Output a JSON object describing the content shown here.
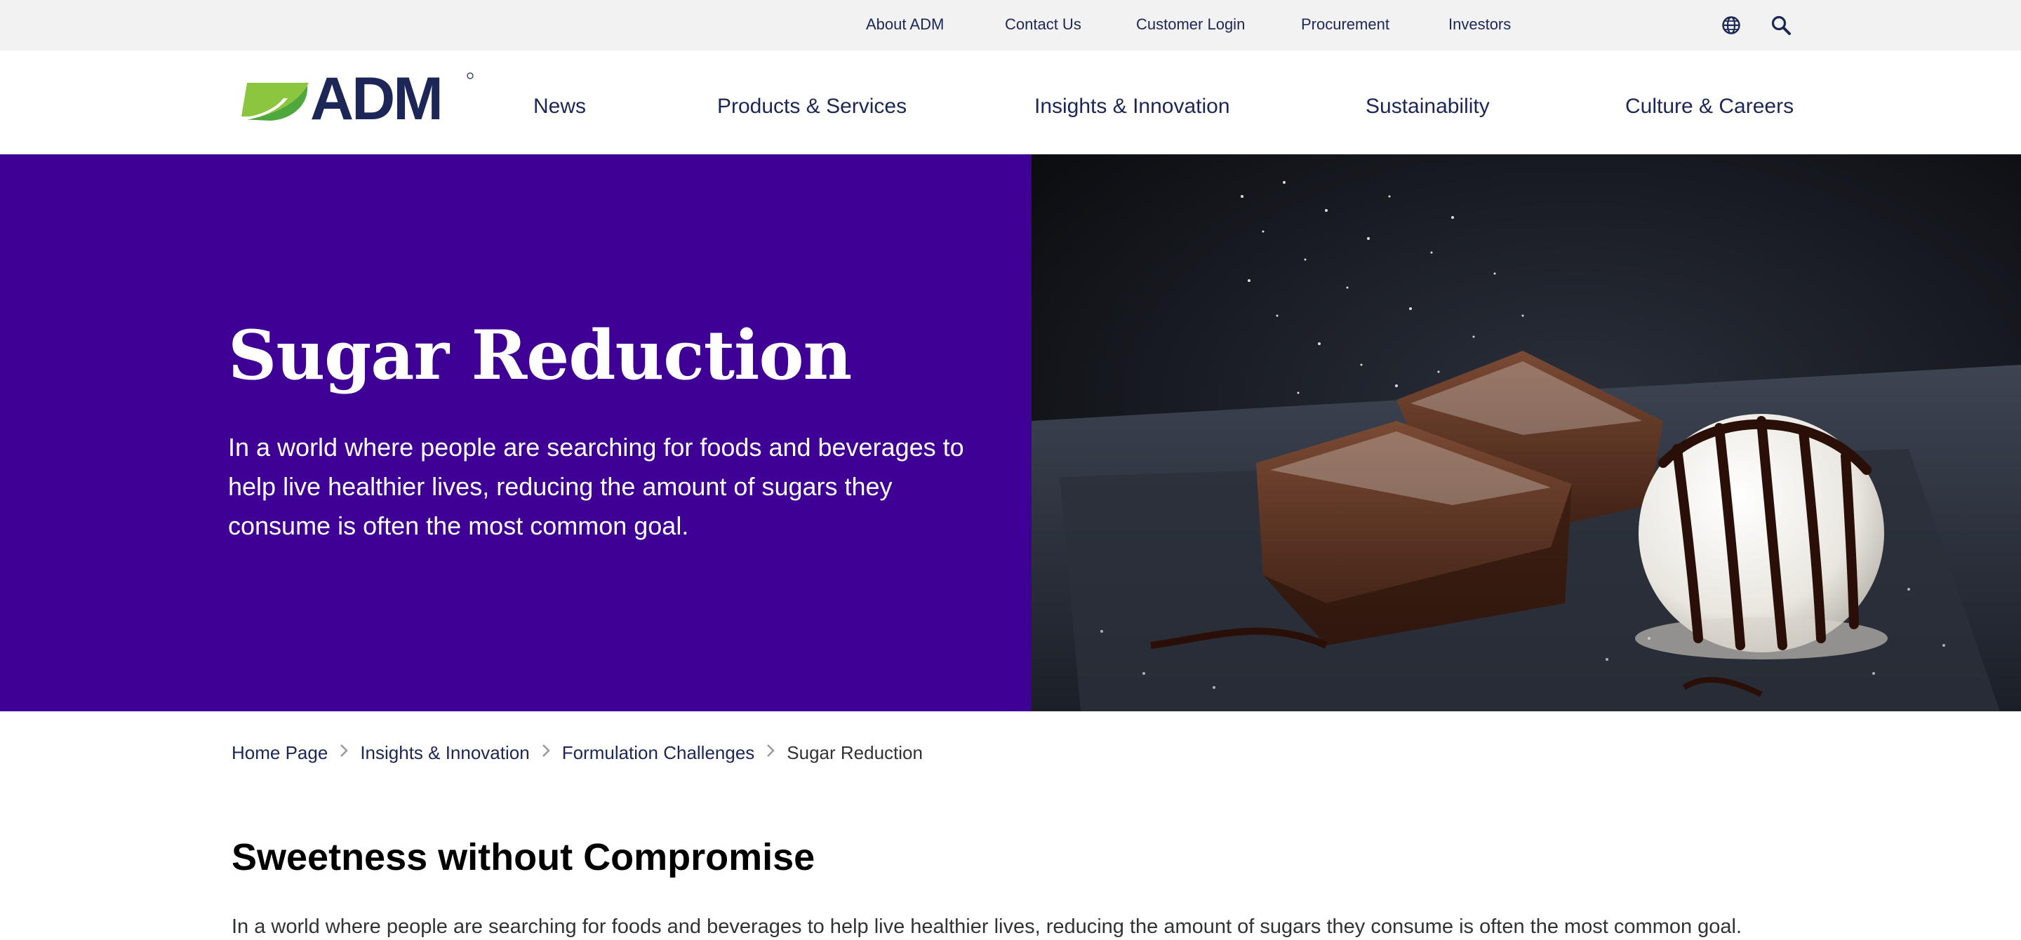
{
  "utility_nav": {
    "links": [
      "About ADM",
      "Contact Us",
      "Customer Login",
      "Procurement",
      "Investors"
    ],
    "icons": [
      "globe-icon",
      "search-icon"
    ]
  },
  "brand": {
    "logo_text": "ADM",
    "leaf_color_light": "#8cc63f",
    "leaf_color_dark": "#4fa83d",
    "wordmark_color": "#1c2657"
  },
  "main_nav": {
    "items": [
      "News",
      "Products & Services",
      "Insights & Innovation",
      "Sustainability",
      "Culture & Careers"
    ]
  },
  "hero": {
    "title": "Sugar Reduction",
    "description": "In a world where people are searching for foods and beverages to help live healthier lives, reducing the amount of sugars they consume is often the most common goal.",
    "background_color": "#3f0096",
    "image": "brownies-and-ice-cream-photo"
  },
  "breadcrumb": {
    "items": [
      "Home Page",
      "Insights & Innovation",
      "Formulation Challenges",
      "Sugar Reduction"
    ],
    "separator_icon": "chevron-right-icon"
  },
  "content": {
    "heading": "Sweetness without Compromise",
    "intro": "In a world where people are searching for foods and beverages to help live healthier lives, reducing the amount of sugars they consume is often the most common goal."
  }
}
